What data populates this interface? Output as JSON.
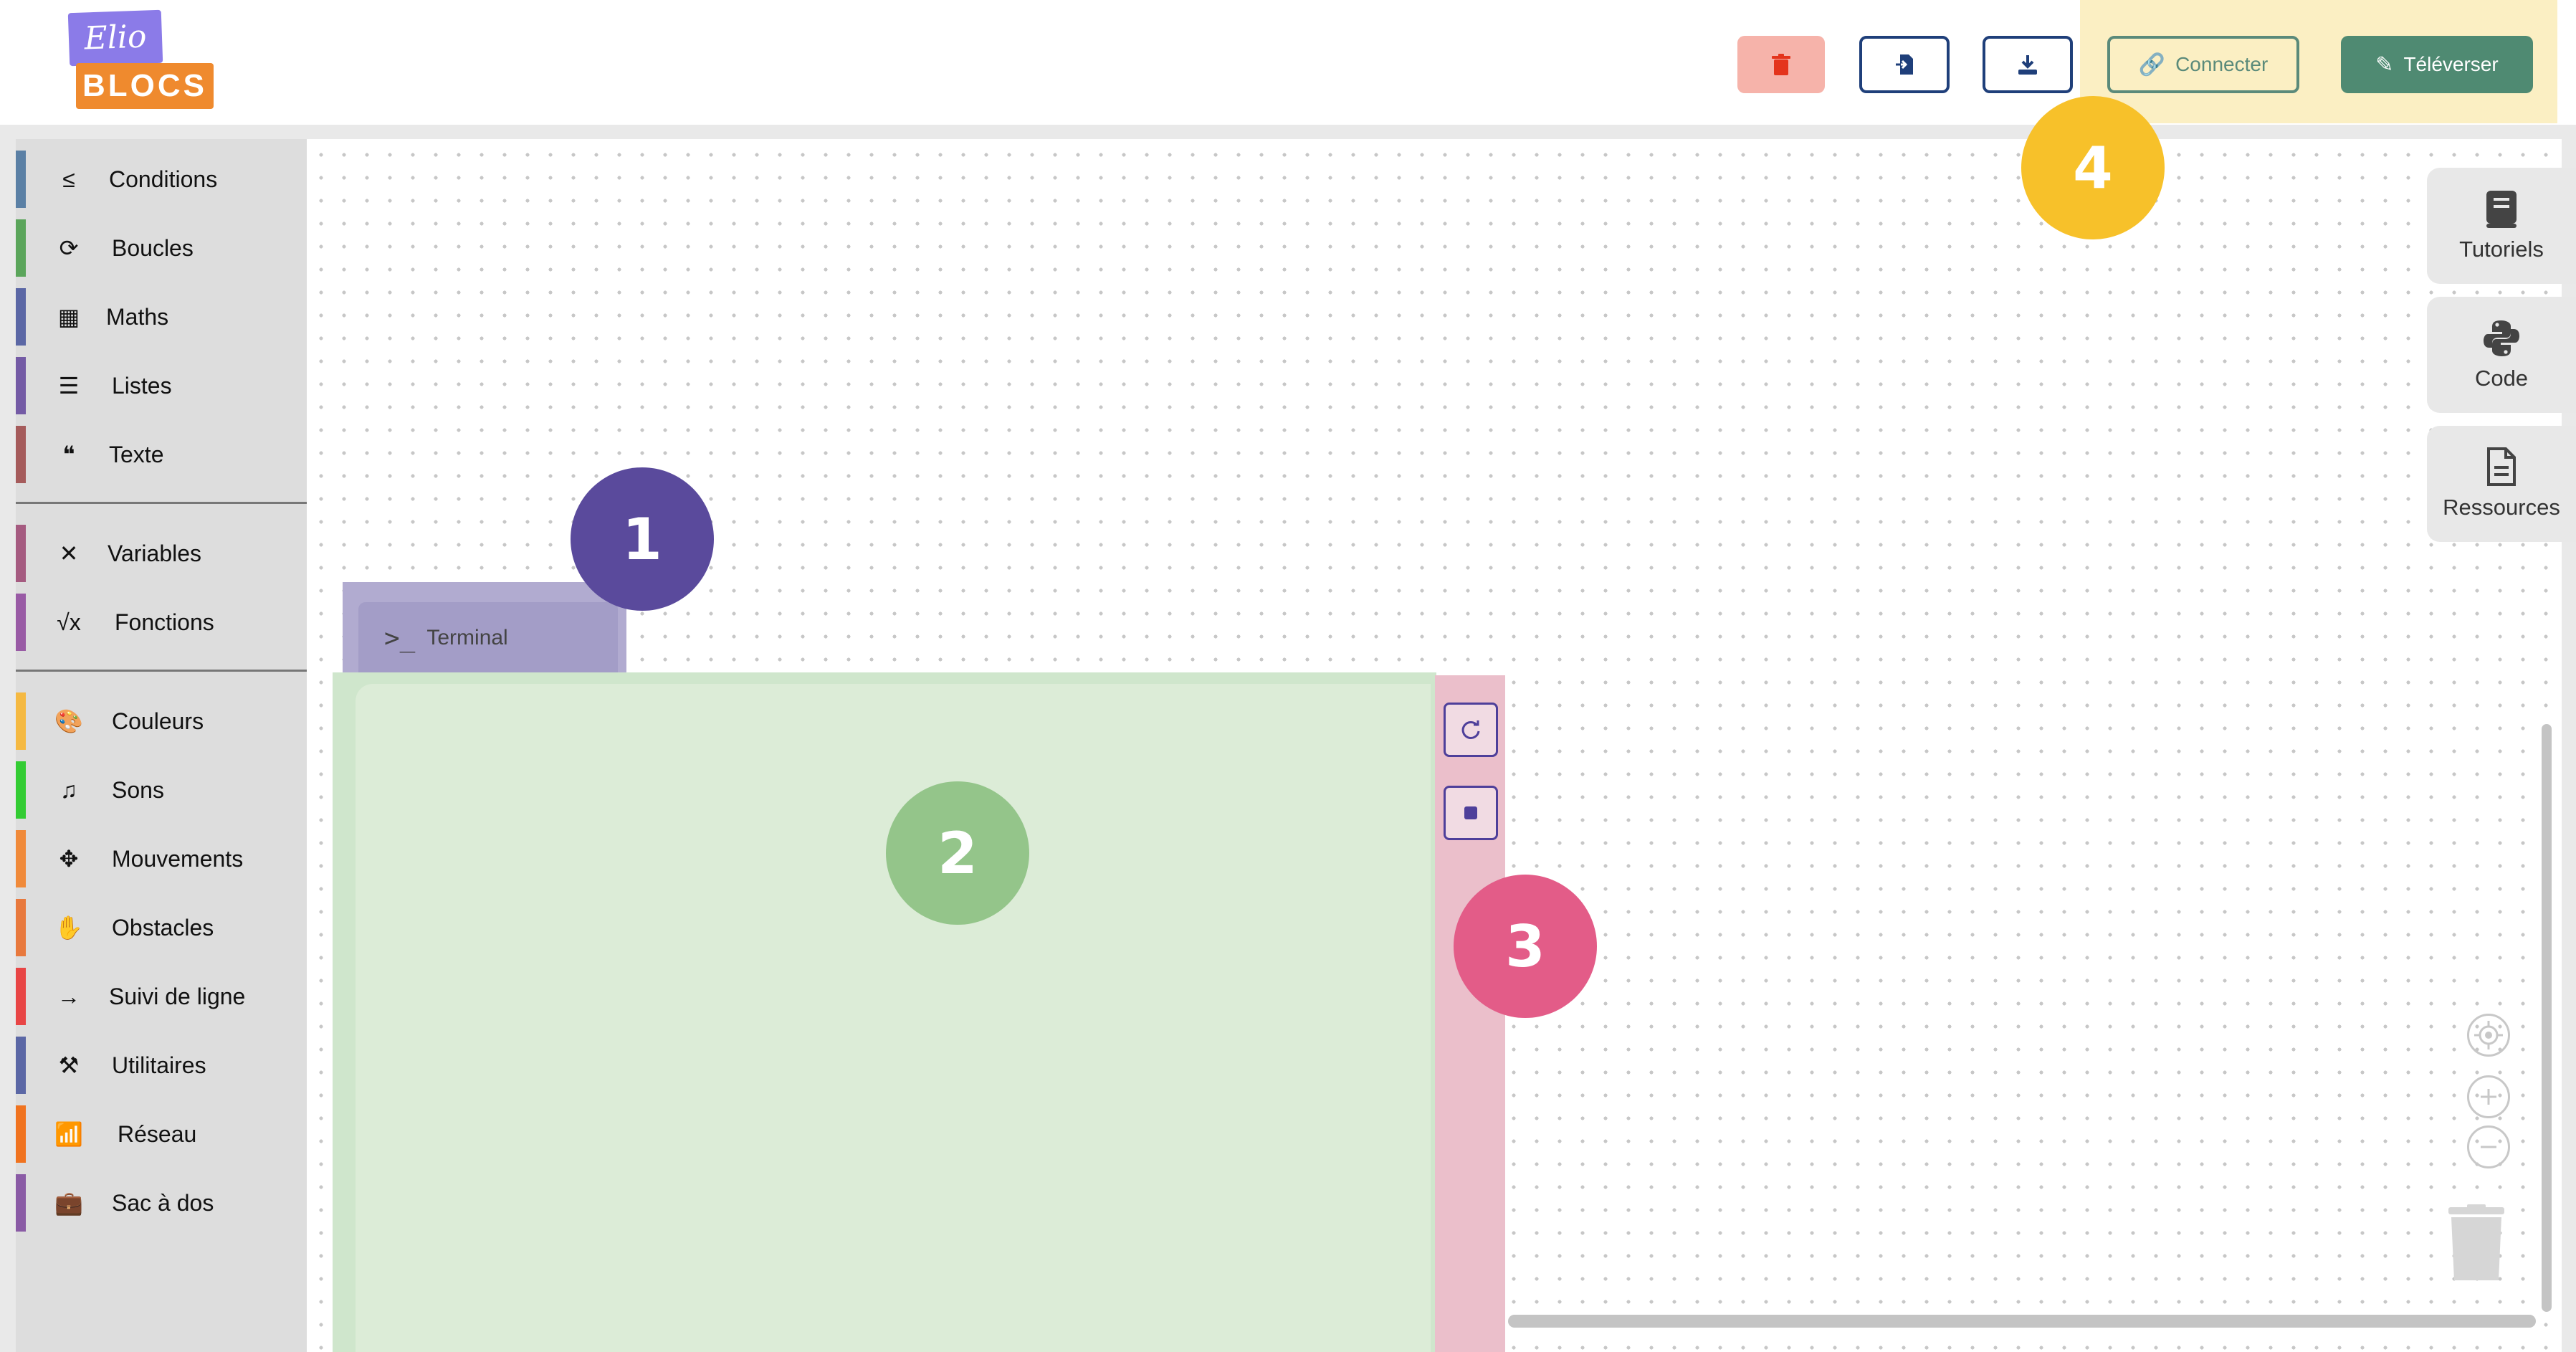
{
  "logo": {
    "top_text": "Elio",
    "bottom_text": "BLOCS"
  },
  "toolbar": {
    "delete_icon": "trash-icon",
    "open_icon": "file-import-icon",
    "save_icon": "download-icon",
    "connect_label": "Connecter",
    "upload_label": "Téléverser"
  },
  "sidebar": {
    "groups": [
      [
        {
          "label": "Conditions",
          "icon": "≤",
          "color": "#5b80a5"
        },
        {
          "label": "Boucles",
          "icon": "⟳",
          "color": "#5ba55b"
        },
        {
          "label": "Maths",
          "icon": "▦",
          "color": "#5b67a5"
        },
        {
          "label": "Listes",
          "icon": "☰",
          "color": "#745ba5"
        },
        {
          "label": "Texte",
          "icon": "❝",
          "color": "#a55b5b"
        }
      ],
      [
        {
          "label": "Variables",
          "icon": "✕",
          "color": "#a55b80"
        },
        {
          "label": "Fonctions",
          "icon": "√x",
          "color": "#995ba5"
        }
      ],
      [
        {
          "label": "Couleurs",
          "icon": "🎨",
          "color": "#f5b942"
        },
        {
          "label": "Sons",
          "icon": "♫",
          "color": "#33cc33"
        },
        {
          "label": "Mouvements",
          "icon": "✥",
          "color": "#f08a3a"
        },
        {
          "label": "Obstacles",
          "icon": "✋",
          "color": "#e8793d"
        },
        {
          "label": "Suivi de ligne",
          "icon": "→",
          "color": "#e84545"
        },
        {
          "label": "Utilitaires",
          "icon": "⚒",
          "color": "#5b67a5"
        },
        {
          "label": "Réseau",
          "icon": "📶",
          "color": "#f0731f"
        },
        {
          "label": "Sac à dos",
          "icon": "💼",
          "color": "#8a5ba5"
        }
      ]
    ]
  },
  "workspace": {
    "terminal_label": "Terminal",
    "markers": [
      "1",
      "2",
      "3",
      "4"
    ],
    "terminal_buttons": [
      "refresh-icon",
      "stop-icon"
    ]
  },
  "right_tabs": [
    {
      "label": "Tutoriels",
      "icon": "book-icon"
    },
    {
      "label": "Code",
      "icon": "python-icon"
    },
    {
      "label": "Ressources",
      "icon": "document-icon"
    }
  ],
  "colors": {
    "accent_connect": "#5a8a7a",
    "accent_upload": "#4f8a72",
    "delete_bg": "#f6b3aa",
    "marker_1": "#5a4a9c",
    "marker_2": "#94c58a",
    "marker_3": "#e35c88",
    "marker_4": "#f7c12a"
  }
}
